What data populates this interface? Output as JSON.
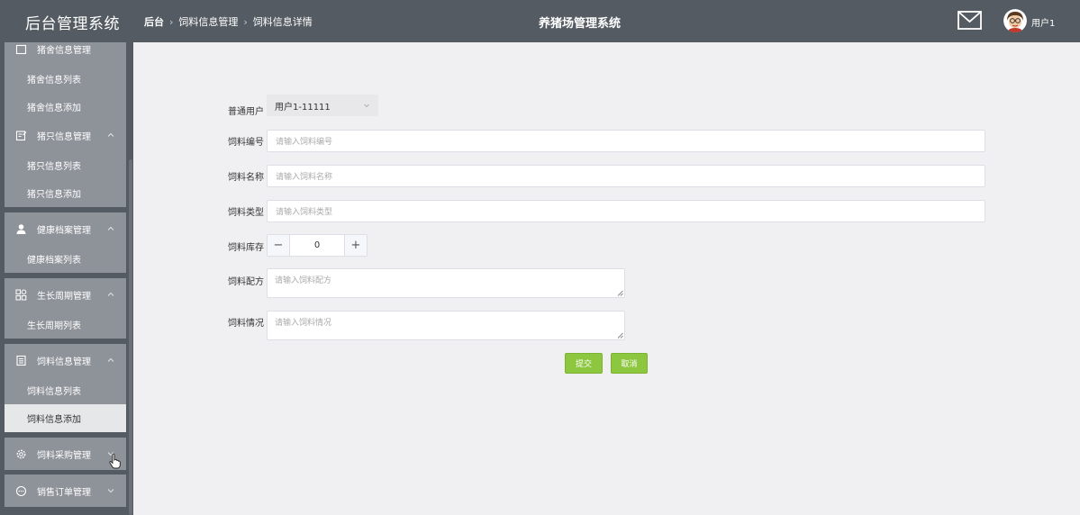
{
  "header": {
    "brand": "后台管理系统",
    "breadcrumb": [
      "后台",
      "饲料信息管理",
      "饲料信息详情"
    ],
    "system_title": "养猪场管理系统",
    "user_name": "用户1"
  },
  "sidebar": {
    "groups": [
      {
        "label": "猪舍信息管理",
        "items": [
          "猪舍信息列表",
          "猪舍信息添加"
        ]
      },
      {
        "label": "猪只信息管理",
        "items": [
          "猪只信息列表",
          "猪只信息添加"
        ]
      },
      {
        "label": "健康档案管理",
        "items": [
          "健康档案列表"
        ]
      },
      {
        "label": "生长周期管理",
        "items": [
          "生长周期列表"
        ]
      },
      {
        "label": "饲料信息管理",
        "items": [
          "饲料信息列表",
          "饲料信息添加"
        ]
      },
      {
        "label": "饲料采购管理",
        "items": []
      },
      {
        "label": "销售订单管理",
        "items": []
      }
    ],
    "active_item": "饲料信息添加"
  },
  "form": {
    "user": {
      "label": "普通用户",
      "value": "用户1-11111"
    },
    "code": {
      "label": "饲料编号",
      "placeholder": "请输入饲料编号"
    },
    "name": {
      "label": "饲料名称",
      "placeholder": "请输入饲料名称"
    },
    "type": {
      "label": "饲料类型",
      "placeholder": "请输入饲料类型"
    },
    "stock": {
      "label": "饲料库存",
      "value": "0"
    },
    "formula": {
      "label": "饲料配方",
      "placeholder": "请输入饲料配方"
    },
    "status": {
      "label": "饲料情况",
      "placeholder": "请输入饲料情况"
    },
    "submit_label": "提交",
    "cancel_label": "取消"
  },
  "colors": {
    "header_bg": "#545b62",
    "sidebar_group_bg": "#8e9299",
    "accent_green": "#8dc63f"
  }
}
